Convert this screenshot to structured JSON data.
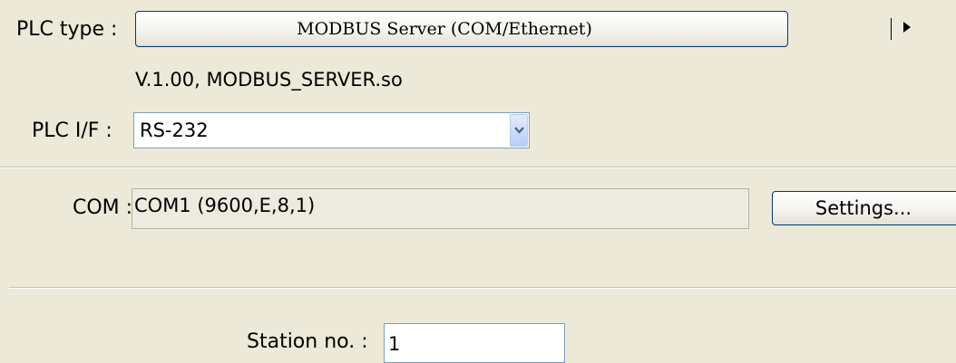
{
  "plc_type": {
    "label": "PLC type :",
    "value": "MODBUS Server (COM/Ethernet)",
    "version": "V.1.00, MODBUS_SERVER.so"
  },
  "plc_if": {
    "label": "PLC I/F :",
    "selected": "RS-232"
  },
  "com": {
    "label": "COM :",
    "value": "COM1 (9600,E,8,1)",
    "settings_label": "Settings..."
  },
  "station": {
    "label": "Station no. :",
    "value": "1"
  }
}
